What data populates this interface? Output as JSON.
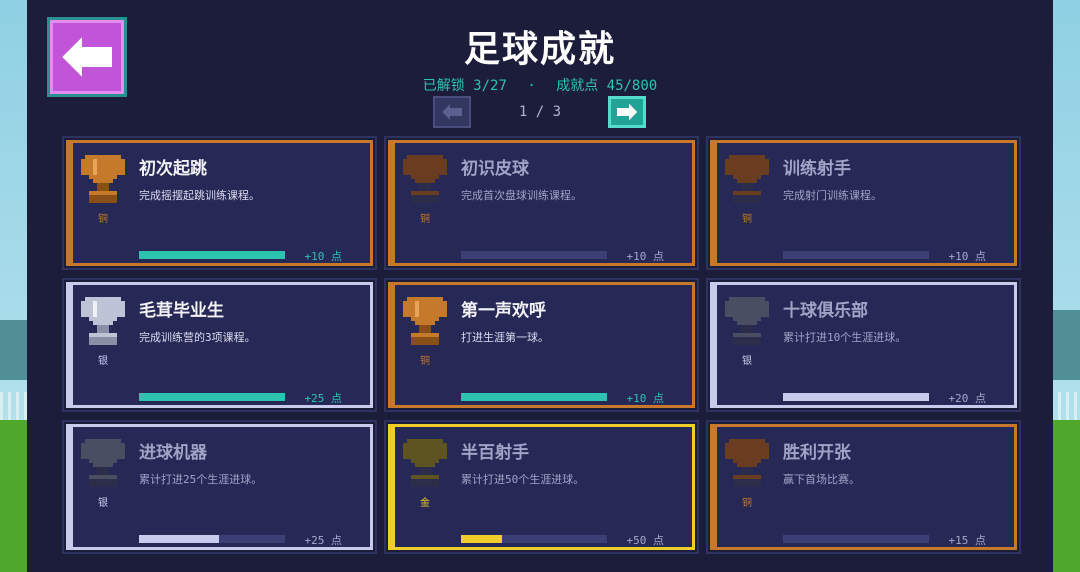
{
  "title": "足球成就",
  "stats": {
    "unlocked": "已解锁 3/27",
    "separator": "·",
    "points": "成就点 45/800"
  },
  "pagination": {
    "text": "1 / 3"
  },
  "colors": {
    "bronze": "#c7782c",
    "silver": "#c8ccec",
    "gold": "#f1cd2c",
    "teal": "#2ec2b0",
    "panel": "#1b1d3b",
    "card": "#262856",
    "back": "#c154d8"
  },
  "achievements": [
    {
      "name": "初次起跳",
      "desc": "完成摇摆起跳训练课程。",
      "tier_label": "铜",
      "tier": "bronze",
      "unlocked": true,
      "progress": 1.0,
      "points": "+10 点"
    },
    {
      "name": "初识皮球",
      "desc": "完成首次盘球训练课程。",
      "tier_label": "铜",
      "tier": "bronze",
      "unlocked": false,
      "progress": 0.0,
      "points": "+10 点"
    },
    {
      "name": "训练射手",
      "desc": "完成射门训练课程。",
      "tier_label": "铜",
      "tier": "bronze",
      "unlocked": false,
      "progress": 0.0,
      "points": "+10 点"
    },
    {
      "name": "毛茸毕业生",
      "desc": "完成训练营的3项课程。",
      "tier_label": "银",
      "tier": "silver",
      "unlocked": true,
      "progress": 1.0,
      "points": "+25 点"
    },
    {
      "name": "第一声欢呼",
      "desc": "打进生涯第一球。",
      "tier_label": "铜",
      "tier": "bronze",
      "unlocked": true,
      "progress": 1.0,
      "points": "+10 点"
    },
    {
      "name": "十球俱乐部",
      "desc": "累计打进10个生涯进球。",
      "tier_label": "银",
      "tier": "silver",
      "unlocked": false,
      "progress": 1.0,
      "points": "+20 点"
    },
    {
      "name": "进球机器",
      "desc": "累计打进25个生涯进球。",
      "tier_label": "银",
      "tier": "silver",
      "unlocked": false,
      "progress": 0.55,
      "points": "+25 点"
    },
    {
      "name": "半百射手",
      "desc": "累计打进50个生涯进球。",
      "tier_label": "金",
      "tier": "gold",
      "unlocked": false,
      "progress": 0.28,
      "points": "+50 点"
    },
    {
      "name": "胜利开张",
      "desc": "赢下首场比赛。",
      "tier_label": "铜",
      "tier": "bronze",
      "unlocked": false,
      "progress": 0.0,
      "points": "+15 点"
    }
  ]
}
